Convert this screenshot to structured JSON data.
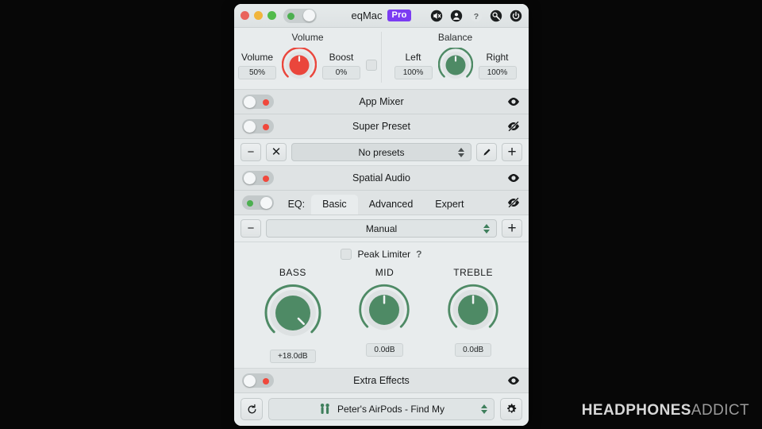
{
  "window": {
    "title": "eqMac",
    "badge": "Pro",
    "traffic_lights": [
      "close",
      "minimize",
      "zoom"
    ],
    "master_toggle_on": true,
    "icons": [
      {
        "name": "mute-icon",
        "label": "Mute"
      },
      {
        "name": "account-icon",
        "label": "Account"
      },
      {
        "name": "help-icon",
        "label": "?"
      },
      {
        "name": "settings-icon",
        "label": "Settings"
      },
      {
        "name": "power-icon",
        "label": "Quit"
      }
    ]
  },
  "volume": {
    "heading": "Volume",
    "label": "Volume",
    "value": "50%",
    "boost_label": "Boost",
    "boost_value": "0%",
    "boost_checked": false,
    "knob_color": "#ea463c"
  },
  "balance": {
    "heading": "Balance",
    "left_label": "Left",
    "left_value": "100%",
    "right_label": "Right",
    "right_value": "100%",
    "knob_color": "#4e8a65"
  },
  "sections": {
    "app_mixer": {
      "title": "App Mixer",
      "enabled": false,
      "visible": true
    },
    "super_preset": {
      "title": "Super Preset",
      "enabled": false,
      "visible": false
    },
    "spatial_audio": {
      "title": "Spatial Audio",
      "enabled": false,
      "visible": true
    },
    "extra_effects": {
      "title": "Extra Effects",
      "enabled": false,
      "visible": true
    }
  },
  "presets": {
    "remove_label": "−",
    "clear_label": "✕",
    "selected": "No presets",
    "edit_label": "edit",
    "add_label": "+"
  },
  "eq": {
    "label": "EQ:",
    "enabled": true,
    "visible": false,
    "tabs": [
      {
        "label": "Basic",
        "active": true
      },
      {
        "label": "Advanced",
        "active": false
      },
      {
        "label": "Expert",
        "active": false
      }
    ],
    "preset_remove_label": "−",
    "preset_selected": "Manual",
    "preset_add_label": "+",
    "peak_limiter_label": "Peak Limiter",
    "peak_limiter_checked": false,
    "help_label": "?",
    "bands": [
      {
        "name": "BASS",
        "value": "+18.0dB",
        "angle": 135,
        "active": true
      },
      {
        "name": "MID",
        "value": "0.0dB",
        "angle": 0,
        "active": false
      },
      {
        "name": "TREBLE",
        "value": "0.0dB",
        "angle": 0,
        "active": false
      }
    ]
  },
  "device": {
    "refresh_label": "refresh",
    "name": "Peter's AirPods - Find My",
    "settings_label": "settings"
  },
  "watermark": {
    "bold": "HEADPHONES",
    "thin": "ADDICT"
  },
  "colors": {
    "accent_green": "#4e8a65",
    "accent_red": "#ea463c",
    "pro_purple": "#7b3cf2",
    "toggle_off_red": "#f0483c",
    "toggle_on_green": "#4caf50",
    "window_bg": "#e8eced",
    "row_bg": "#dfe3e4",
    "desktop_bg": "#070707"
  }
}
